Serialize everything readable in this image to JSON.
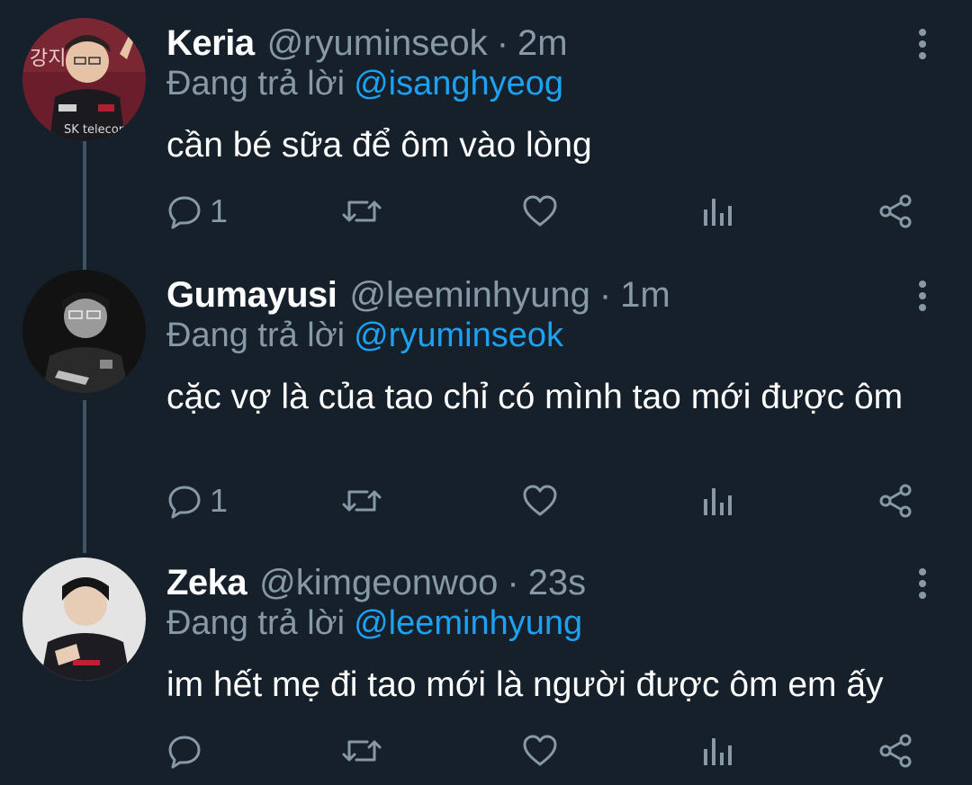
{
  "tweets": [
    {
      "display_name": "Keria",
      "handle": "@ryuminseok",
      "separator": "·",
      "time": "2m",
      "replying_prefix": "Đang trả lời",
      "replying_to": "@isanghyeog",
      "text": "cần bé sữa để ôm vào lòng",
      "reply_count": "1",
      "avatar_icon": "keria-avatar"
    },
    {
      "display_name": "Gumayusi",
      "handle": "@leeminhyung",
      "separator": "·",
      "time": "1m",
      "replying_prefix": "Đang trả lời",
      "replying_to": "@ryuminseok",
      "text": "cặc vợ là của tao chỉ có mình tao mới được ôm",
      "reply_count": "1",
      "avatar_icon": "gumayusi-avatar"
    },
    {
      "display_name": "Zeka",
      "handle": "@kimgeonwoo",
      "separator": "·",
      "time": "23s",
      "replying_prefix": "Đang trả lời",
      "replying_to": "@leeminhyung",
      "text": "im hết mẹ đi tao mới là người được ôm em ấy",
      "reply_count": "",
      "avatar_icon": "zeka-avatar"
    }
  ],
  "colors": {
    "background": "#15202b",
    "muted": "#8899a6",
    "mention": "#1da1f2",
    "thread_line": "#3d5466"
  },
  "icons": [
    "reply-icon",
    "retweet-icon",
    "like-icon",
    "views-icon",
    "share-icon",
    "more-options-icon"
  ]
}
